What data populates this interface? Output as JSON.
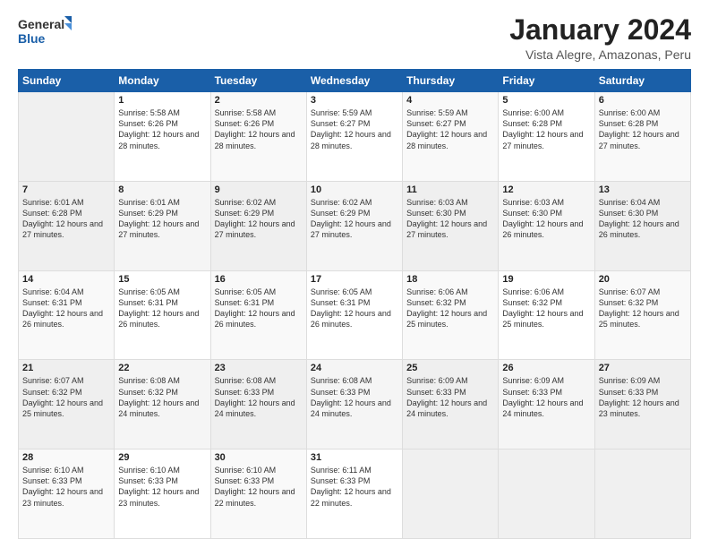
{
  "logo": {
    "line1": "General",
    "line2": "Blue"
  },
  "title": "January 2024",
  "subtitle": "Vista Alegre, Amazonas, Peru",
  "headers": [
    "Sunday",
    "Monday",
    "Tuesday",
    "Wednesday",
    "Thursday",
    "Friday",
    "Saturday"
  ],
  "weeks": [
    [
      {
        "day": "",
        "sunrise": "",
        "sunset": "",
        "daylight": ""
      },
      {
        "day": "1",
        "sunrise": "Sunrise: 5:58 AM",
        "sunset": "Sunset: 6:26 PM",
        "daylight": "Daylight: 12 hours and 28 minutes."
      },
      {
        "day": "2",
        "sunrise": "Sunrise: 5:58 AM",
        "sunset": "Sunset: 6:26 PM",
        "daylight": "Daylight: 12 hours and 28 minutes."
      },
      {
        "day": "3",
        "sunrise": "Sunrise: 5:59 AM",
        "sunset": "Sunset: 6:27 PM",
        "daylight": "Daylight: 12 hours and 28 minutes."
      },
      {
        "day": "4",
        "sunrise": "Sunrise: 5:59 AM",
        "sunset": "Sunset: 6:27 PM",
        "daylight": "Daylight: 12 hours and 28 minutes."
      },
      {
        "day": "5",
        "sunrise": "Sunrise: 6:00 AM",
        "sunset": "Sunset: 6:28 PM",
        "daylight": "Daylight: 12 hours and 27 minutes."
      },
      {
        "day": "6",
        "sunrise": "Sunrise: 6:00 AM",
        "sunset": "Sunset: 6:28 PM",
        "daylight": "Daylight: 12 hours and 27 minutes."
      }
    ],
    [
      {
        "day": "7",
        "sunrise": "Sunrise: 6:01 AM",
        "sunset": "Sunset: 6:28 PM",
        "daylight": "Daylight: 12 hours and 27 minutes."
      },
      {
        "day": "8",
        "sunrise": "Sunrise: 6:01 AM",
        "sunset": "Sunset: 6:29 PM",
        "daylight": "Daylight: 12 hours and 27 minutes."
      },
      {
        "day": "9",
        "sunrise": "Sunrise: 6:02 AM",
        "sunset": "Sunset: 6:29 PM",
        "daylight": "Daylight: 12 hours and 27 minutes."
      },
      {
        "day": "10",
        "sunrise": "Sunrise: 6:02 AM",
        "sunset": "Sunset: 6:29 PM",
        "daylight": "Daylight: 12 hours and 27 minutes."
      },
      {
        "day": "11",
        "sunrise": "Sunrise: 6:03 AM",
        "sunset": "Sunset: 6:30 PM",
        "daylight": "Daylight: 12 hours and 27 minutes."
      },
      {
        "day": "12",
        "sunrise": "Sunrise: 6:03 AM",
        "sunset": "Sunset: 6:30 PM",
        "daylight": "Daylight: 12 hours and 26 minutes."
      },
      {
        "day": "13",
        "sunrise": "Sunrise: 6:04 AM",
        "sunset": "Sunset: 6:30 PM",
        "daylight": "Daylight: 12 hours and 26 minutes."
      }
    ],
    [
      {
        "day": "14",
        "sunrise": "Sunrise: 6:04 AM",
        "sunset": "Sunset: 6:31 PM",
        "daylight": "Daylight: 12 hours and 26 minutes."
      },
      {
        "day": "15",
        "sunrise": "Sunrise: 6:05 AM",
        "sunset": "Sunset: 6:31 PM",
        "daylight": "Daylight: 12 hours and 26 minutes."
      },
      {
        "day": "16",
        "sunrise": "Sunrise: 6:05 AM",
        "sunset": "Sunset: 6:31 PM",
        "daylight": "Daylight: 12 hours and 26 minutes."
      },
      {
        "day": "17",
        "sunrise": "Sunrise: 6:05 AM",
        "sunset": "Sunset: 6:31 PM",
        "daylight": "Daylight: 12 hours and 26 minutes."
      },
      {
        "day": "18",
        "sunrise": "Sunrise: 6:06 AM",
        "sunset": "Sunset: 6:32 PM",
        "daylight": "Daylight: 12 hours and 25 minutes."
      },
      {
        "day": "19",
        "sunrise": "Sunrise: 6:06 AM",
        "sunset": "Sunset: 6:32 PM",
        "daylight": "Daylight: 12 hours and 25 minutes."
      },
      {
        "day": "20",
        "sunrise": "Sunrise: 6:07 AM",
        "sunset": "Sunset: 6:32 PM",
        "daylight": "Daylight: 12 hours and 25 minutes."
      }
    ],
    [
      {
        "day": "21",
        "sunrise": "Sunrise: 6:07 AM",
        "sunset": "Sunset: 6:32 PM",
        "daylight": "Daylight: 12 hours and 25 minutes."
      },
      {
        "day": "22",
        "sunrise": "Sunrise: 6:08 AM",
        "sunset": "Sunset: 6:32 PM",
        "daylight": "Daylight: 12 hours and 24 minutes."
      },
      {
        "day": "23",
        "sunrise": "Sunrise: 6:08 AM",
        "sunset": "Sunset: 6:33 PM",
        "daylight": "Daylight: 12 hours and 24 minutes."
      },
      {
        "day": "24",
        "sunrise": "Sunrise: 6:08 AM",
        "sunset": "Sunset: 6:33 PM",
        "daylight": "Daylight: 12 hours and 24 minutes."
      },
      {
        "day": "25",
        "sunrise": "Sunrise: 6:09 AM",
        "sunset": "Sunset: 6:33 PM",
        "daylight": "Daylight: 12 hours and 24 minutes."
      },
      {
        "day": "26",
        "sunrise": "Sunrise: 6:09 AM",
        "sunset": "Sunset: 6:33 PM",
        "daylight": "Daylight: 12 hours and 24 minutes."
      },
      {
        "day": "27",
        "sunrise": "Sunrise: 6:09 AM",
        "sunset": "Sunset: 6:33 PM",
        "daylight": "Daylight: 12 hours and 23 minutes."
      }
    ],
    [
      {
        "day": "28",
        "sunrise": "Sunrise: 6:10 AM",
        "sunset": "Sunset: 6:33 PM",
        "daylight": "Daylight: 12 hours and 23 minutes."
      },
      {
        "day": "29",
        "sunrise": "Sunrise: 6:10 AM",
        "sunset": "Sunset: 6:33 PM",
        "daylight": "Daylight: 12 hours and 23 minutes."
      },
      {
        "day": "30",
        "sunrise": "Sunrise: 6:10 AM",
        "sunset": "Sunset: 6:33 PM",
        "daylight": "Daylight: 12 hours and 22 minutes."
      },
      {
        "day": "31",
        "sunrise": "Sunrise: 6:11 AM",
        "sunset": "Sunset: 6:33 PM",
        "daylight": "Daylight: 12 hours and 22 minutes."
      },
      {
        "day": "",
        "sunrise": "",
        "sunset": "",
        "daylight": ""
      },
      {
        "day": "",
        "sunrise": "",
        "sunset": "",
        "daylight": ""
      },
      {
        "day": "",
        "sunrise": "",
        "sunset": "",
        "daylight": ""
      }
    ]
  ]
}
